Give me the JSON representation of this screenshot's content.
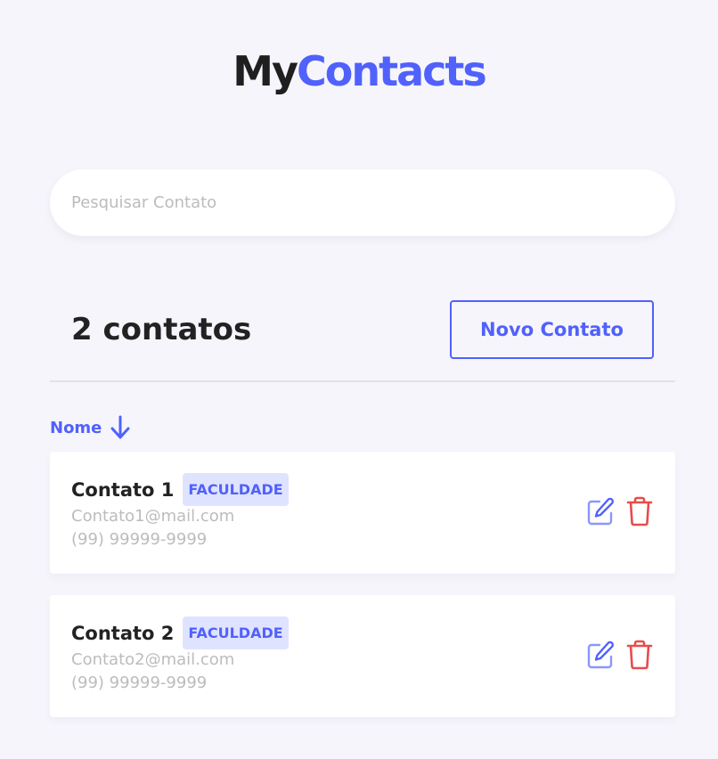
{
  "header": {
    "logo_part1": "My",
    "logo_part2": "Contacts"
  },
  "search": {
    "placeholder": "Pesquisar Contato",
    "value": ""
  },
  "list_header": {
    "count_label": "2 contatos",
    "new_button_label": "Novo Contato"
  },
  "sort": {
    "label": "Nome",
    "icon": "arrow-down-icon"
  },
  "contacts": [
    {
      "name": "Contato 1",
      "category": "FACULDADE",
      "email": "Contato1@mail.com",
      "phone": "(99) 99999-9999"
    },
    {
      "name": "Contato 2",
      "category": "FACULDADE",
      "email": "Contato2@mail.com",
      "phone": "(99) 99999-9999"
    }
  ],
  "icons": {
    "edit": "edit-icon",
    "delete": "trash-icon"
  },
  "colors": {
    "background": "#f6f5fc",
    "primary": "#5061fc",
    "primary_light": "#e0e3ff",
    "danger": "#e84c4c",
    "text": "#222222",
    "muted": "#bcbcbc"
  }
}
